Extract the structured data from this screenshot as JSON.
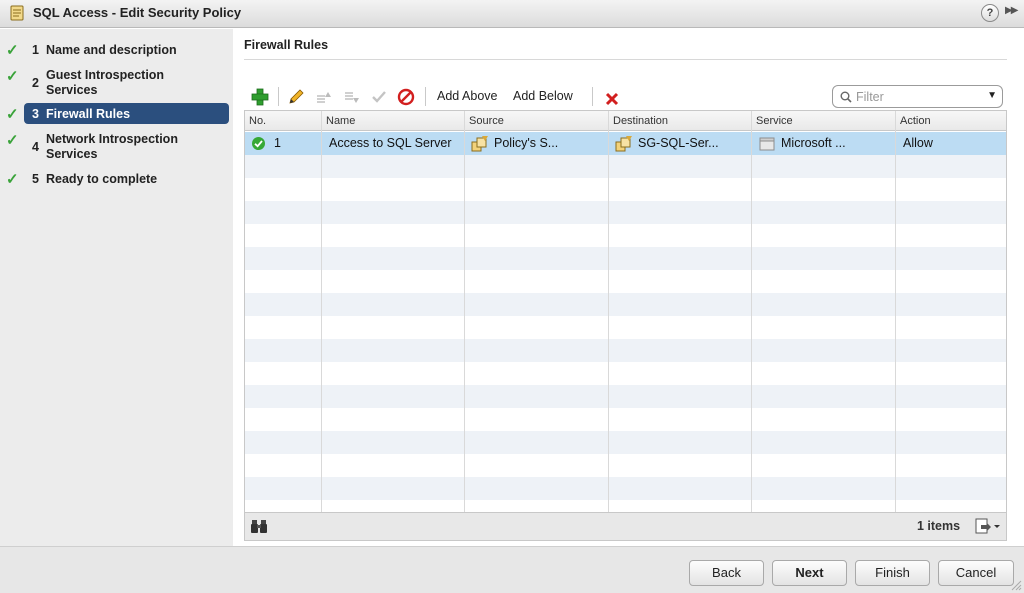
{
  "window": {
    "title": "SQL Access - Edit Security Policy",
    "help_label": "?",
    "expand_label": "▶▶"
  },
  "steps": [
    {
      "num": "1",
      "label": "Name and description",
      "done": true
    },
    {
      "num": "2",
      "label": "Guest Introspection Services",
      "done": true
    },
    {
      "num": "3",
      "label": "Firewall Rules",
      "done": true,
      "active": true
    },
    {
      "num": "4",
      "label": "Network Introspection Services",
      "done": true
    },
    {
      "num": "5",
      "label": "Ready to complete",
      "done": true
    }
  ],
  "main": {
    "title": "Firewall Rules",
    "toolbar": {
      "add_above": "Add Above",
      "add_below": "Add Below",
      "icons": [
        "add-icon",
        "edit-icon",
        "move-up-icon",
        "move-down-icon",
        "enable-icon",
        "disable-icon",
        "delete-icon"
      ]
    },
    "filter": {
      "placeholder": "Filter",
      "value": ""
    },
    "table": {
      "columns": [
        "No.",
        "Name",
        "Source",
        "Destination",
        "Service",
        "Action"
      ],
      "rows": [
        {
          "no": "1",
          "name": "Access to SQL Server",
          "source": "Policy's S...",
          "destination": "SG-SQL-Ser...",
          "service": "Microsoft ...",
          "action": "Allow",
          "status": "enabled",
          "selected": true
        }
      ]
    },
    "footer": {
      "items_count": "1 items"
    }
  },
  "buttons": {
    "back": "Back",
    "next": "Next",
    "finish": "Finish",
    "cancel": "Cancel"
  },
  "colors": {
    "active_step": "#2b4f7e",
    "selected_row": "#bcdcf3",
    "check": "#3aa33a",
    "add": "#2e9e2e",
    "delete": "#d21f1f"
  }
}
